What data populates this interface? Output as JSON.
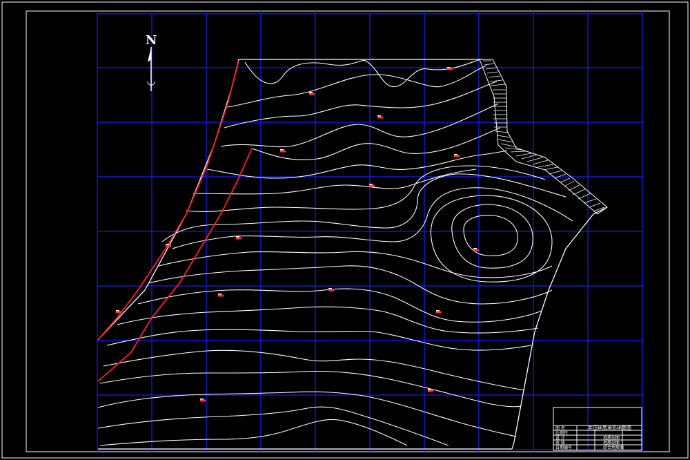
{
  "north_arrow": {
    "label": "N"
  },
  "title_block": {
    "title": "井田地质地形地质图",
    "rows": [
      {
        "left": "图 名",
        "right": ""
      },
      {
        "left": "比例尺",
        "right": ""
      },
      {
        "left": "设 计",
        "right": "地质剖面"
      },
      {
        "left": "审 核",
        "right": "地质剖面"
      },
      {
        "left": "日期编号",
        "right": "综合地质图"
      }
    ]
  },
  "colors": {
    "background": "#000000",
    "frame": "#ffffff",
    "grid": "#1a1aff",
    "contour": "#ffffff",
    "fault": "#ff2020",
    "boundary_hatch": "#ffffff",
    "borehole_marker": "#ff3030"
  }
}
